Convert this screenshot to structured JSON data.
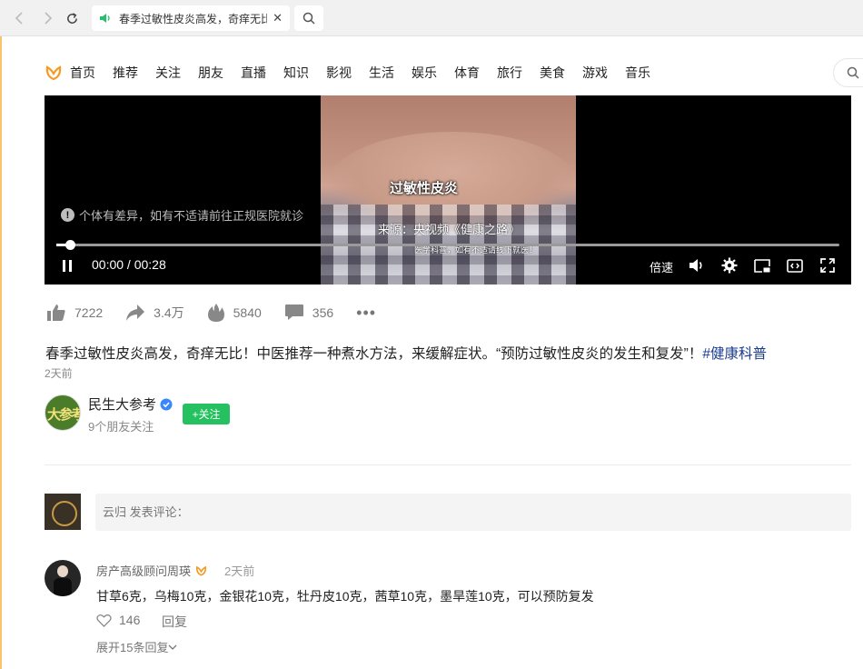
{
  "browser": {
    "tab_title": "春季过敏性皮炎高发，奇痒无比",
    "icons": [
      "back-icon",
      "forward-icon",
      "reload-icon",
      "speaker-icon",
      "close-icon",
      "search-icon"
    ]
  },
  "site_nav": {
    "items": [
      "首页",
      "推荐",
      "关注",
      "朋友",
      "直播",
      "知识",
      "影视",
      "生活",
      "娱乐",
      "体育",
      "旅行",
      "美食",
      "游戏",
      "音乐"
    ]
  },
  "video": {
    "caption_main": "过敏性皮炎",
    "caption_source": "来源：央视频《健康之路》",
    "caption_tiny": "医学科普，如有不适请线下就医！",
    "warning": "个体有差异，如有不适请前往正规医院就诊",
    "current_time": "00:00",
    "duration": "00:28",
    "time_display": "00:00 / 00:28",
    "progress_fraction": 0.017,
    "speed_label": "倍速"
  },
  "stats": {
    "likes": "7222",
    "shares": "3.4万",
    "hot": "5840",
    "comments": "356"
  },
  "post": {
    "title_text": "春季过敏性皮炎高发，奇痒无比！中医推荐一种煮水方法，来缓解症状。“预防过敏性皮炎的发生和复发”！",
    "hashtag": "#健康科普",
    "date": "2天前"
  },
  "author": {
    "name": "民生大参考",
    "avatar_text": "大参考",
    "fans": "9个朋友关注",
    "follow_label": "+关注"
  },
  "comment_input": {
    "placeholder": "云归 发表评论："
  },
  "comments": [
    {
      "user": "房产高级顾问周瑛",
      "time": "2天前",
      "text": "甘草6克，乌梅10克，金银花10克，牡丹皮10克，茜草10克，墨旱莲10克，可以预防复发",
      "likes": "146",
      "reply_label": "回复",
      "expand_label": "展开15条回复"
    }
  ],
  "colors": {
    "accent_yellow": "#f7c36b",
    "follow_green": "#25c05f",
    "hashtag_blue": "#1a3c8f",
    "logo_orange": "#f59a23"
  }
}
